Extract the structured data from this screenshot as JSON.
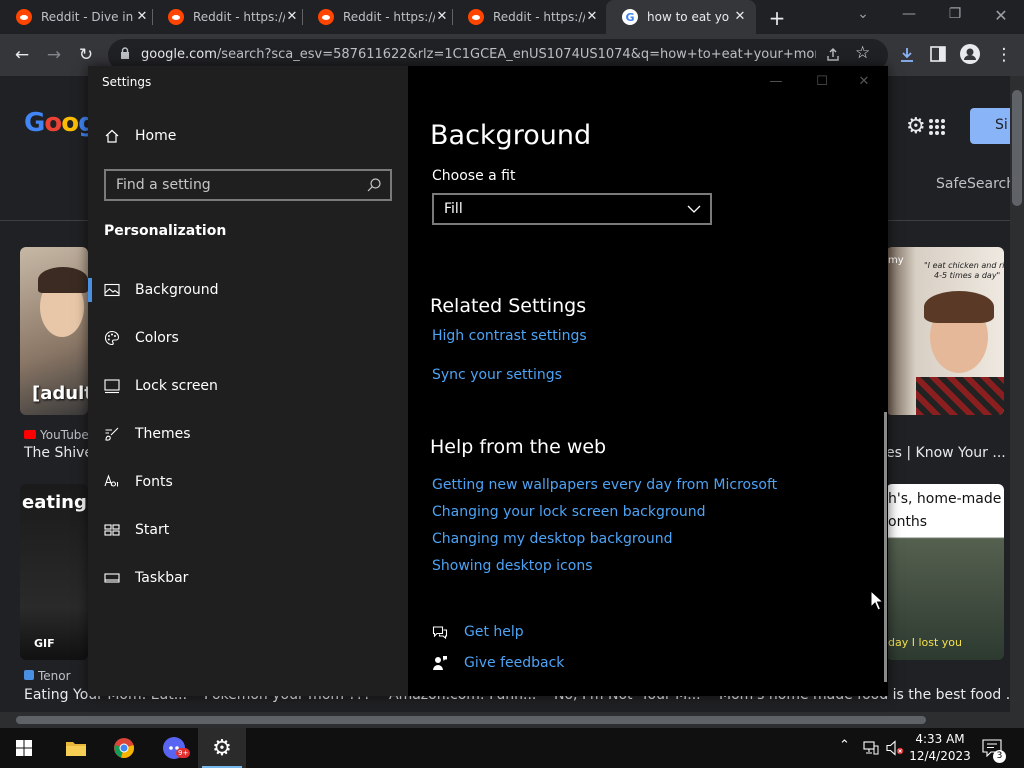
{
  "browser": {
    "tabs": [
      {
        "title": "Reddit - Dive into",
        "favicon": "reddit-icon"
      },
      {
        "title": "Reddit - https://",
        "favicon": "reddit-icon"
      },
      {
        "title": "Reddit - https://",
        "favicon": "reddit-icon"
      },
      {
        "title": "Reddit - https://",
        "favicon": "reddit-icon"
      },
      {
        "title": "how to eat your",
        "favicon": "google-icon",
        "active": true
      }
    ],
    "url_domain": "google.com",
    "url_path": "/search?sca_esv=587611622&rlz=1C1GCEA_enUS1074US1074&q=how+to+eat+your+mom&t..."
  },
  "google": {
    "sign_in_label": "Si",
    "safesearch_label": "SafeSearch",
    "results": [
      {
        "source": "YouTube",
        "title": "The Shiver",
        "badge": "[adult"
      },
      {
        "source": "",
        "title": "es | Know Your ..."
      },
      {
        "source": "Tenor",
        "title": "Eating Your Mom: Eat...",
        "badge": "eating y",
        "gif": "GIF"
      },
      {
        "source": "",
        "title": "Pokémon your mom ???"
      },
      {
        "source": "",
        "title": "Amazon.com: Funn..."
      },
      {
        "source": "",
        "title": "No, I'm Not 'Your M..."
      },
      {
        "source": "",
        "title": "Mom's home made food is the best food ..."
      }
    ],
    "caption_right_top_1": "\"I eat chicken and rice",
    "caption_right_top_2": "4-5 times a day\"",
    "caption_right_top_label": "my",
    "caption_right_mid": "h's, home-made",
    "caption_right_mid2": "onths",
    "caption_right_bottom": "day I lost you"
  },
  "settings": {
    "window_title": "Settings",
    "home_label": "Home",
    "search_placeholder": "Find a setting",
    "section_label": "Personalization",
    "nav": [
      {
        "label": "Background",
        "icon": "image-icon",
        "selected": true
      },
      {
        "label": "Colors",
        "icon": "palette-icon"
      },
      {
        "label": "Lock screen",
        "icon": "lock-screen-icon"
      },
      {
        "label": "Themes",
        "icon": "brush-icon"
      },
      {
        "label": "Fonts",
        "icon": "fonts-icon"
      },
      {
        "label": "Start",
        "icon": "start-icon"
      },
      {
        "label": "Taskbar",
        "icon": "taskbar-icon"
      }
    ],
    "page_title": "Background",
    "fit_label": "Choose a fit",
    "fit_value": "Fill",
    "related_heading": "Related Settings",
    "related_links": [
      "High contrast settings",
      "Sync your settings"
    ],
    "help_heading": "Help from the web",
    "help_links": [
      "Getting new wallpapers every day from Microsoft",
      "Changing your lock screen background",
      "Changing my desktop background",
      "Showing desktop icons"
    ],
    "get_help": "Get help",
    "give_feedback": "Give feedback"
  },
  "taskbar": {
    "time": "4:33 AM",
    "date": "12/4/2023",
    "notification_count": "3",
    "discord_badge": "9+"
  },
  "colors": {
    "accent": "#4ea3f5",
    "selection_bar": "#4a90e2",
    "settings_nav_bg": "#1f1f1f",
    "settings_content_bg": "#000000"
  }
}
